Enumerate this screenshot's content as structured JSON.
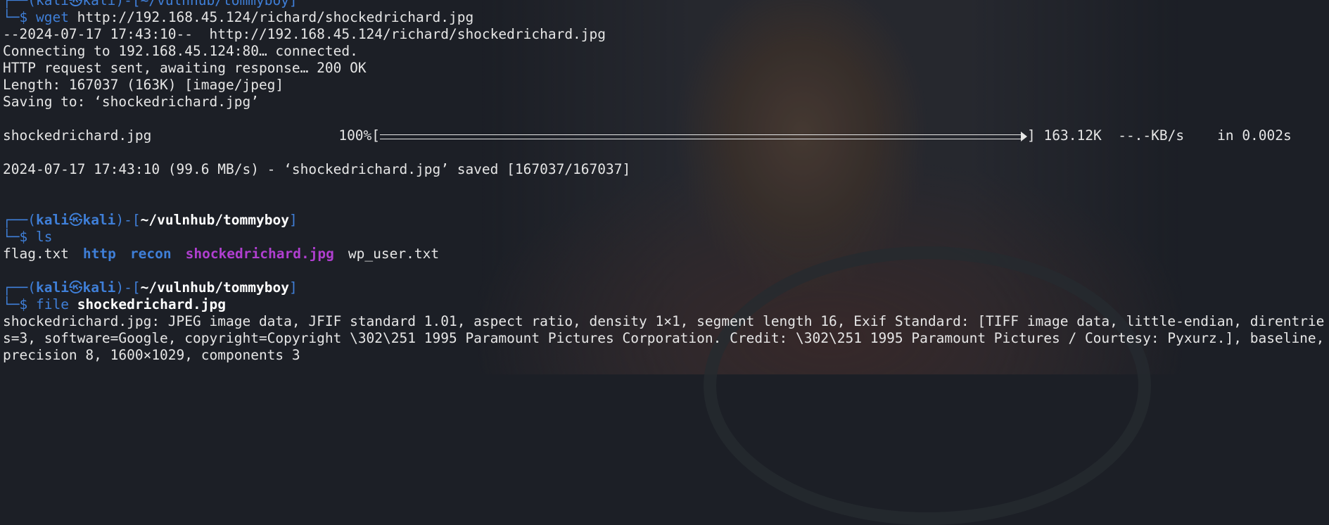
{
  "prompt": {
    "open": "┌──(",
    "user": "kali",
    "at": "㉿",
    "host": "kali",
    "mid": ")-[",
    "close": "]",
    "arrow": "└─$ "
  },
  "top": {
    "cut_prompt": "┌──(kali㉿kali)-[~/vulnhub/tommyboy]",
    "wget_cmd": "wget",
    "wget_arg": " http://192.168.45.124/richard/shockedrichard.jpg"
  },
  "wget_output": [
    "--2024-07-17 17:43:10--  http://192.168.45.124/richard/shockedrichard.jpg",
    "Connecting to 192.168.45.124:80… connected.",
    "HTTP request sent, awaiting response… 200 OK",
    "Length: 167037 (163K) [image/jpeg]",
    "Saving to: ‘shockedrichard.jpg’"
  ],
  "progress": {
    "filename": "shockedrichard.jpg",
    "percent_label": "100%[",
    "fraction": 1.0,
    "end": "]",
    "size": "163.12K",
    "speed": "--.-KB/s",
    "time": "in 0.002s"
  },
  "saved_line": "2024-07-17 17:43:10 (99.6 MB/s) - ‘shockedrichard.jpg’ saved [167037/167037]",
  "ls_block": {
    "path": "~/vulnhub/tommyboy",
    "cmd": "ls",
    "items": [
      {
        "name": "flag.txt",
        "kind": "file"
      },
      {
        "name": "http",
        "kind": "dir"
      },
      {
        "name": "recon",
        "kind": "dir"
      },
      {
        "name": "shockedrichard.jpg",
        "kind": "image"
      },
      {
        "name": "wp_user.txt",
        "kind": "file"
      }
    ]
  },
  "file_block": {
    "path": "~/vulnhub/tommyboy",
    "cmd": "file",
    "arg": "shockedrichard.jpg",
    "output": [
      "shockedrichard.jpg: JPEG image data, JFIF standard 1.01, aspect ratio, density 1×1, segment length 16, Exif Standard: [TIFF image data, little-endian, direntries=3, software=Google, copyright=Copyright \\302\\251 1995 Paramount Pictures Corporation. Credit: \\302\\251 1995 Paramount Pictures / Courtesy: Pyxurz.], baseline, precision 8, 1600×1029, components 3"
    ]
  },
  "colors": {
    "background": "#1c1f26",
    "prompt_blue": "#3f7fd8",
    "image_purple": "#b03fd0",
    "text": "#e6e6e6"
  }
}
